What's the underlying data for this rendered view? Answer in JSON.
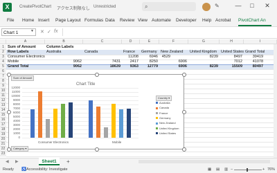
{
  "window": {
    "title": "CreatePivotChart",
    "status": "アクセス制限なし",
    "saved": "Unrestricted",
    "minimize": "—",
    "maximize": "□",
    "close": "✕"
  },
  "ribbon": {
    "tabs": [
      "File",
      "Home",
      "Insert",
      "Page Layout",
      "Formulas",
      "Data",
      "Review",
      "View",
      "Automate",
      "Developer",
      "Help",
      "Acrobat",
      "PivotChart An"
    ]
  },
  "formula_bar": {
    "name_box": "Chart 1",
    "cancel": "✕",
    "enter": "✓",
    "fx": "fx",
    "value": ""
  },
  "columns": [
    "A",
    "B",
    "C",
    "D",
    "E",
    "F",
    "G",
    "H",
    "I"
  ],
  "pivot": {
    "r1": {
      "a": "Sum of Amount",
      "b": "Column Labels"
    },
    "r2": {
      "a": "Row Labels",
      "b": "Australia",
      "c": "Canada",
      "d": "France",
      "e": "Germany",
      "f": "New Zealand",
      "g": "United Kingdom",
      "h": "United States",
      "i": "Grand Total"
    },
    "r3": {
      "a": "Consumer Electronics",
      "d": "11208",
      "e": "6946",
      "f": "4529",
      "h": "8239",
      "i": "8497",
      "j": "39419"
    },
    "r4": {
      "a": "Mobile",
      "b": "9062",
      "c": "7431",
      "d": "2417",
      "e": "8250",
      "f": "6906",
      "i": "7012",
      "j": "41078"
    },
    "r5": {
      "a": "Grand Total",
      "b": "9062",
      "c": "18639",
      "d": "9363",
      "e": "12779",
      "f": "6906",
      "h": "8239",
      "i": "15509",
      "j": "80497"
    }
  },
  "rows": [
    "1",
    "2",
    "3",
    "4",
    "5",
    "6",
    "7",
    "8",
    "9",
    "10",
    "11",
    "12",
    "13",
    "14",
    "15",
    "16",
    "17",
    "18",
    "19",
    "20",
    "21",
    "22",
    "23",
    "24",
    "25"
  ],
  "chart": {
    "field_button_value": "Sum of Amount",
    "field_button_axis": "Category",
    "field_button_legend": "Country",
    "title": "Chart Title",
    "y_ticks": [
      "12000",
      "11000",
      "10000",
      "9000",
      "8000",
      "7000",
      "6000",
      "5000",
      "4000",
      "3000",
      "2000",
      "1000",
      "0"
    ],
    "x_labels": [
      "Consumer Electronics",
      "Mobile"
    ],
    "legend": [
      "Australia",
      "Canada",
      "France",
      "Germany",
      "New Zealand",
      "United Kingdom",
      "United States"
    ]
  },
  "chart_data": {
    "type": "bar",
    "title": "Chart Title",
    "categories": [
      "Consumer Electronics",
      "Mobile"
    ],
    "ylim": [
      0,
      12000
    ],
    "series": [
      {
        "name": "Australia",
        "values": [
          6900,
          9000
        ]
      },
      {
        "name": "Canada",
        "values": [
          11208,
          7431
        ]
      },
      {
        "name": "France",
        "values": [
          4529,
          2417
        ]
      },
      {
        "name": "Germany",
        "values": [
          6946,
          8250
        ]
      },
      {
        "name": "New Zealand",
        "values": [
          0,
          6906
        ]
      },
      {
        "name": "United Kingdom",
        "values": [
          8239,
          0
        ]
      },
      {
        "name": "United States",
        "values": [
          8497,
          7012
        ]
      }
    ],
    "colors": [
      "#4472c4",
      "#ed7d31",
      "#a5a5a5",
      "#ffc000",
      "#5b9bd5",
      "#70ad47",
      "#264478"
    ],
    "legend_position": "right",
    "grid": true
  },
  "sheet": {
    "tab": "Sheet1",
    "add": "+"
  },
  "status": {
    "ready": "Ready",
    "accessibility": "Accessibility: Investigate",
    "zoom": "76%"
  }
}
